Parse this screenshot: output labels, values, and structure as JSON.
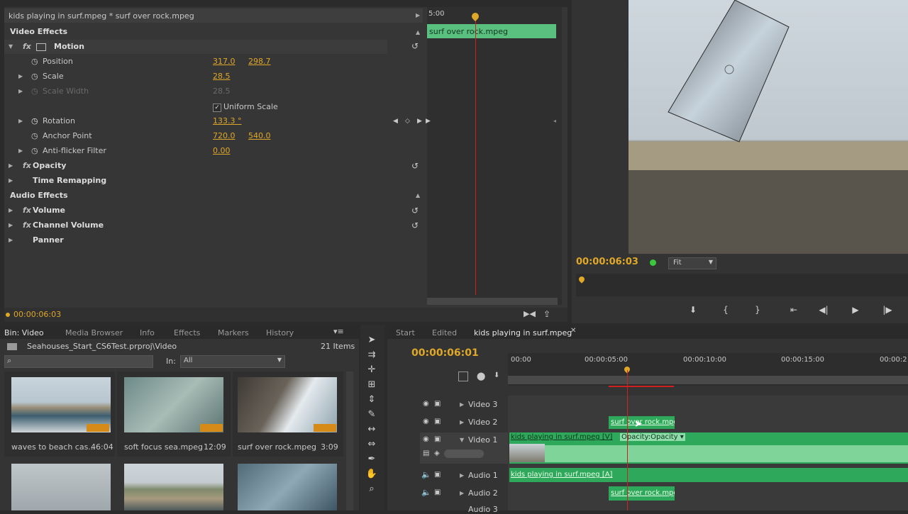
{
  "effect_controls": {
    "sequence_title": "kids playing in surf.mpeg * surf over rock.mpeg",
    "timeline_time": "5:00",
    "clip_label": "surf over rock.mpeg",
    "video_effects_label": "Video Effects",
    "motion_label": "Motion",
    "position_label": "Position",
    "position_x": "317.0",
    "position_y": "298.7",
    "scale_label": "Scale",
    "scale_value": "28.5",
    "scale_width_label": "Scale Width",
    "scale_width_value": "28.5",
    "uniform_scale_label": "Uniform Scale",
    "rotation_label": "Rotation",
    "rotation_value": "133.3 °",
    "anchor_label": "Anchor Point",
    "anchor_x": "720.0",
    "anchor_y": "540.0",
    "antiflicker_label": "Anti-flicker Filter",
    "antiflicker_value": "0.00",
    "opacity_label": "Opacity",
    "time_remap_label": "Time Remapping",
    "audio_effects_label": "Audio Effects",
    "volume_label": "Volume",
    "channel_volume_label": "Channel Volume",
    "panner_label": "Panner",
    "current_time": "00:00:06:03"
  },
  "program": {
    "timecode": "00:00:06:03",
    "zoom_label": "Fit"
  },
  "project": {
    "tabs": [
      "Bin: Video",
      "Media Browser",
      "Info",
      "Effects",
      "Markers",
      "History"
    ],
    "path": "Seahouses_Start_CS6Test.prproj\\Video",
    "item_count": "21 Items",
    "in_label": "In:",
    "in_value": "All",
    "items": [
      {
        "name": "waves to beach cas...",
        "duration": "46:04"
      },
      {
        "name": "soft focus sea.mpeg",
        "duration": "12:09"
      },
      {
        "name": "surf over rock.mpeg",
        "duration": "3:09"
      }
    ]
  },
  "timeline": {
    "tabs": [
      "Start",
      "Edited",
      "kids playing in surf.mpeg"
    ],
    "timecode": "00:00:06:01",
    "ruler": [
      "00:00",
      "00:00:05:00",
      "00:00:10:00",
      "00:00:15:00",
      "00:00:2"
    ],
    "tracks": {
      "v3": "Video 3",
      "v2": "Video 2",
      "v1": "Video 1",
      "a1": "Audio 1",
      "a2": "Audio 2",
      "a3": "Audio 3"
    },
    "clip_v2": "surf over rock.mpg",
    "clip_v1": "kids playing in surf.mpeg [V]",
    "clip_v1_fx": "Opacity:Opacity ▾",
    "clip_a1": "kids playing in surf.mpeg [A]",
    "clip_a2": "surf over rock.mpg"
  },
  "colors": {
    "accent_gold": "#e0a828",
    "clip_green": "#2ea85a",
    "playhead_red": "#d02020"
  }
}
